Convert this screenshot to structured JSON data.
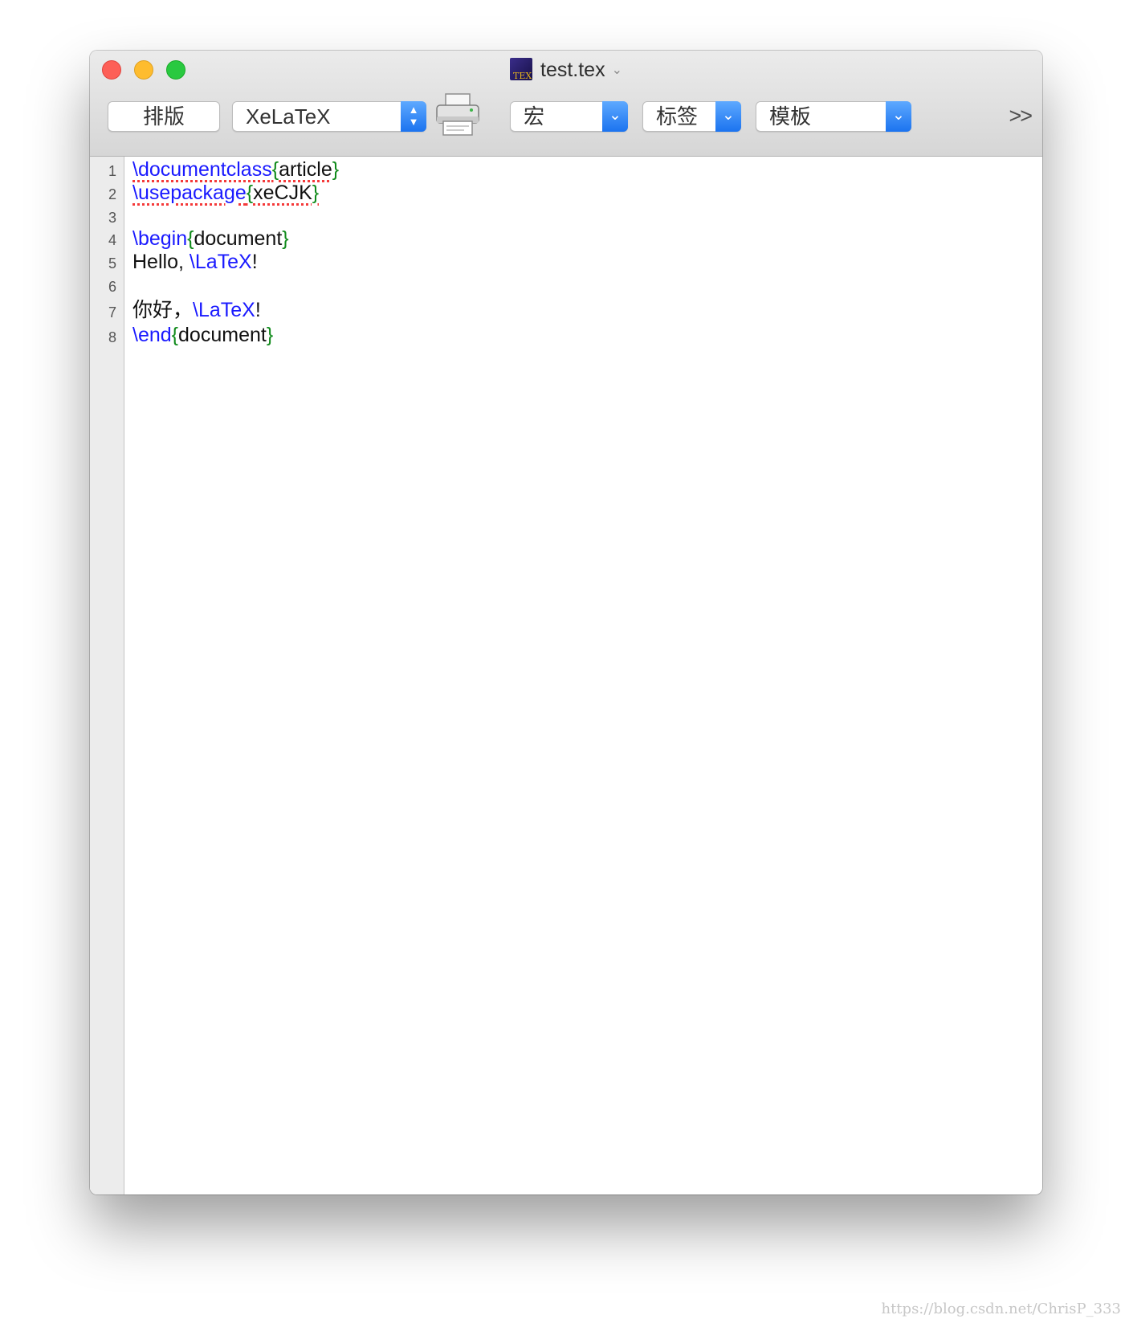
{
  "window": {
    "title": "test.tex",
    "title_menu_indicator": "⌄",
    "traffic_lights": {
      "close": "#fd5f57",
      "minimize": "#febc2e",
      "zoom": "#29c940"
    }
  },
  "toolbar": {
    "typeset_label": "排版",
    "engine_value": "XeLaTeX",
    "macro_label": "宏",
    "tags_label": "标签",
    "templates_label": "模板",
    "overflow_label": ">>"
  },
  "editor": {
    "line_numbers": [
      "1",
      "2",
      "3",
      "4",
      "5",
      "6",
      "7",
      "8"
    ],
    "lines": [
      {
        "cmd": "\\documentclass",
        "open": "{",
        "arg": "article",
        "close": "}"
      },
      {
        "cmd": "\\usepackage",
        "open": "{",
        "arg": "xeCJK",
        "close": "}"
      },
      {
        "text": ""
      },
      {
        "cmd": "\\begin",
        "open": "{",
        "arg": "document",
        "close": "}"
      },
      {
        "prefix": "Hello, ",
        "cmd": "\\LaTeX",
        "suffix": "!"
      },
      {
        "text": ""
      },
      {
        "prefix": "你好，",
        "cmd": "\\LaTeX",
        "suffix": "!"
      },
      {
        "cmd": "\\end",
        "open": "{",
        "arg": "document",
        "close": "}"
      }
    ],
    "colors": {
      "command": "#1a1aff",
      "brace": "#0f8a1a",
      "text": "#111111",
      "spell_mark": "#f43a3a"
    }
  },
  "watermark": "https://blog.csdn.net/ChrisP_333"
}
